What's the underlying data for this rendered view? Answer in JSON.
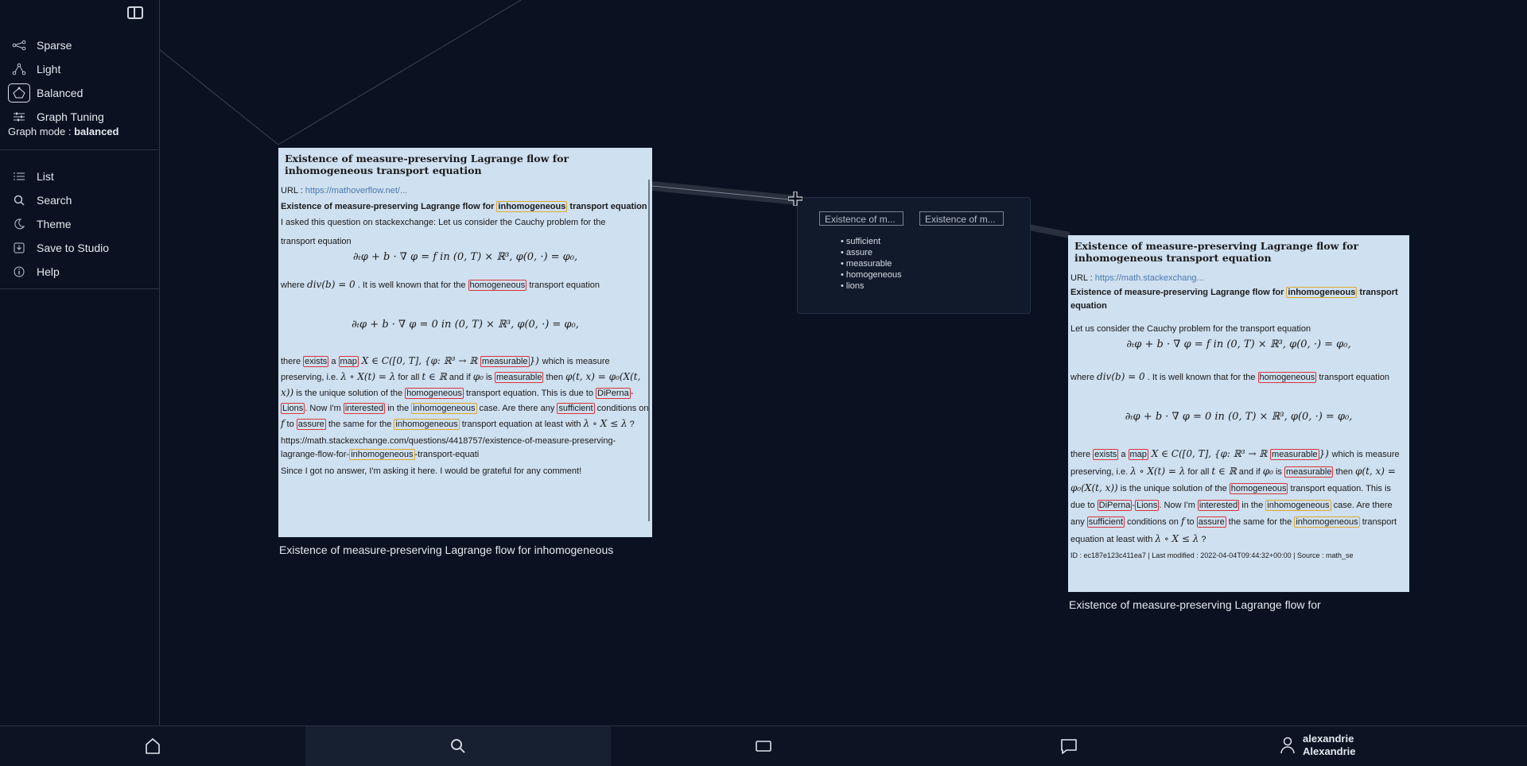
{
  "sidebar": {
    "modes": [
      {
        "label": "Sparse",
        "icon": "sparse-graph-icon"
      },
      {
        "label": "Light",
        "icon": "light-graph-icon"
      },
      {
        "label": "Balanced",
        "icon": "balanced-graph-icon"
      },
      {
        "label": "Graph Tuning",
        "icon": "tuning-sliders-icon"
      }
    ],
    "graph_mode_label": "Graph mode : ",
    "graph_mode_value": "balanced",
    "menu": [
      {
        "label": "List",
        "icon": "list-icon"
      },
      {
        "label": "Search",
        "icon": "search-icon"
      },
      {
        "label": "Theme",
        "icon": "moon-icon"
      },
      {
        "label": "Save to Studio",
        "icon": "save-icon"
      },
      {
        "label": "Help",
        "icon": "info-icon"
      }
    ]
  },
  "left_card": {
    "title": "Existence of measure-preserving Lagrange flow for inhomogeneous transport equation",
    "url_label": "URL : ",
    "url": "https://mathoverflow.net/...",
    "bold_pre": "Existence of measure-preserving Lagrange flow for ",
    "bold_kw": "inhomogeneous",
    "bold_post": " transport equation",
    "intro": "I asked this question on stackexchange: Let us consider the Cauchy problem for the",
    "intro2": "transport equation",
    "eq1": "∂ₜφ + b · ∇ φ = f  in  (0, T) × ℝ³, φ(0, ·) = φ₀,",
    "where_pre": "where ",
    "where_math": "div(b) = 0",
    "where_post": " . It is well known that for the ",
    "where_kw": "homogeneous",
    "where_end": " transport equation",
    "eq2": "∂ₜφ + b · ∇ φ = 0  in  (0, T) × ℝ³, φ(0, ·) = φ₀,",
    "link_text": "https://math.stackexchange.com/questions/4418757/existence-of-measure-preserving-",
    "link_text2_pre": "lagrange-flow-for-",
    "link_text2_kw": "inhomogeneous",
    "link_text2_post": "-transport-equati",
    "closing": "Since I got no answer, I'm asking it here. I would be grateful for any comment!",
    "caption": "Existence of measure-preserving Lagrange flow for inhomogeneous"
  },
  "link_box": {
    "chip1": "Existence of m...",
    "chip2": "Existence of m...",
    "keywords": [
      "sufficient",
      "assure",
      "measurable",
      "homogeneous",
      "lions"
    ]
  },
  "right_card": {
    "title": "Existence of measure-preserving Lagrange flow for inhomogeneous transport equation",
    "url_label": "URL : ",
    "url": "https://math.stackexchang...",
    "bold_pre": "Existence of measure-preserving Lagrange flow for ",
    "bold_kw": "inhomogeneous",
    "bold_post": " transport equation",
    "intro": "Let us consider the Cauchy problem for the transport equation",
    "eq1": "∂ₜφ + b · ∇ φ = f  in  (0, T) × ℝ³, φ(0, ·) = φ₀,",
    "where_pre": "where ",
    "where_math": "div(b) = 0",
    "where_post": " . It is well known that for the ",
    "where_kw": "homogeneous",
    "where_end": " transport equation",
    "eq2": "∂ₜφ + b · ∇ φ = 0  in  (0, T) × ℝ³, φ(0, ·) = φ₀,",
    "meta": "ID : ec187e123c411ea7 | Last modified : 2022-04-04T09:44:32+00:00 | Source : math_se",
    "caption": "Existence of measure-preserving Lagrange flow for"
  },
  "para": {
    "there": "there ",
    "exists": "exists",
    "a": " a ",
    "map": "map",
    "setX": " X ∈ C([0, T], {φ: ℝ³ → ℝ ",
    "measurable": "measurable",
    "close": "}) ",
    "which": "which is measure",
    "preserving": "preserving, i.e. ",
    "lam": "λ ∘ X(t) = λ",
    "forall": " for all ",
    "tR": "t ∈ ℝ",
    "andif": " and if ",
    "phi0": "φ₀",
    "is": " is ",
    "then": " then ",
    "phitx": "φ(t, x) = φ₀(X(t, x))",
    "unique": " is the unique solution of the ",
    "homogeneous": "homogeneous",
    "transport_due": " transport equation. This is due to ",
    "diperna": "DiPerna",
    "dash": "-",
    "lions": "Lions",
    "nowim": ". Now I'm ",
    "interested": "interested",
    "inthe": " in the ",
    "inhomogeneous": "inhomogeneous",
    "case": " case. Are there any ",
    "sufficient": "sufficient",
    "conditions": " conditions on ",
    "f": "f",
    "to": " to ",
    "assure": "assure",
    "samefor": " the same for the ",
    "atleast": " transport equation at least with ",
    "lamX": "λ ∘ X ≤ λ",
    "q": " ?"
  },
  "bottom_bar": {
    "user_line1": "alexandrie",
    "user_line2": "Alexandrie"
  }
}
